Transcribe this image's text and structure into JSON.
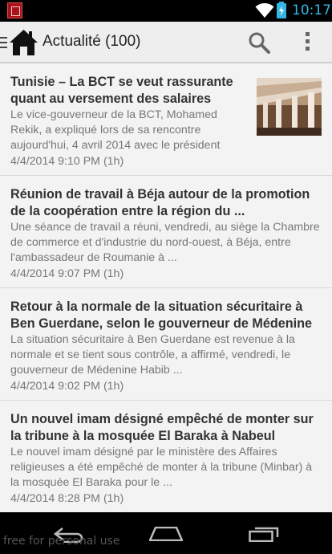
{
  "status_bar": {
    "time": "10:17",
    "icons": [
      "app-notification-icon",
      "wifi-icon",
      "battery-charging-icon"
    ]
  },
  "action_bar": {
    "title": "Actualité (100)",
    "icons": [
      "home-icon",
      "search-icon",
      "overflow-menu-icon"
    ]
  },
  "articles": [
    {
      "title": "Tunisie – La BCT se veut rassurante quant au versement des salaires",
      "description": "Le vice-gouverneur de la BCT, Mohamed Rekik, a expliqué lors de sa rencontre aujourd'hui, 4 avril 2014 avec le président",
      "date": "4/4/2014 9:10 PM (1h)",
      "has_thumbnail": true
    },
    {
      "title": "Réunion de travail à Béja autour de la promotion de la coopération entre la région du ...",
      "description": "Une séance de travail a réuni, vendredi, au siège la Chambre de commerce et d'industrie du nord-ouest, à Béja, entre l'ambassadeur de Roumanie à ...",
      "date": "4/4/2014 9:07 PM (1h)",
      "has_thumbnail": false
    },
    {
      "title": "Retour à la normale de la situation sécuritaire à Ben Guerdane, selon le gouverneur de Médenine",
      "description": "La situation sécuritaire à Ben Guerdane est revenue à la normale et se tient sous contrôle, a affirmé, vendredi, le gouverneur de Médenine Habib ...",
      "date": "4/4/2014 9:02 PM (1h)",
      "has_thumbnail": false
    },
    {
      "title": "Un nouvel imam désigné empêché de monter sur la tribune à la mosquée El Baraka à Nabeul",
      "description": "Le nouvel imam désigné par le ministère des Affaires religieuses a été empêché de monter à la tribune (Minbar) à la mosquée El Baraka pour le ...",
      "date": "4/4/2014 8:28 PM (1h)",
      "has_thumbnail": false
    }
  ],
  "nav_bar": {
    "icons": [
      "back-icon",
      "home-nav-icon",
      "recent-apps-icon"
    ],
    "watermark": "free for personal use"
  },
  "colors": {
    "accent": "#33b5e5",
    "action_bar_bg": "#eeeeee",
    "list_bg": "#f3f3f3",
    "title_text": "#333333",
    "secondary_text": "#777777"
  }
}
